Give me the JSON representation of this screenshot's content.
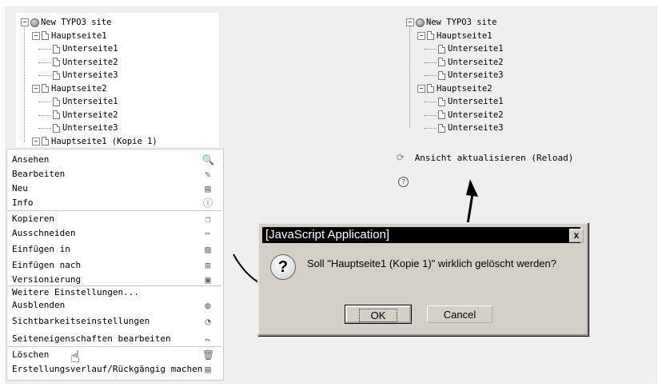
{
  "left_tree": {
    "root": "New TYPO3 site",
    "items": [
      {
        "label": "Hauptseite1"
      },
      {
        "label": "Unterseite1"
      },
      {
        "label": "Unterseite2"
      },
      {
        "label": "Unterseite3"
      },
      {
        "label": "Hauptseite2"
      },
      {
        "label": "Unterseite1"
      },
      {
        "label": "Unterseite2"
      },
      {
        "label": "Unterseite3"
      },
      {
        "label": "Hauptseite1 (Kopie 1)"
      }
    ]
  },
  "right_tree": {
    "root": "New TYPO3 site",
    "items": [
      {
        "label": "Hauptseite1"
      },
      {
        "label": "Unterseite1"
      },
      {
        "label": "Unterseite2"
      },
      {
        "label": "Unterseite3"
      },
      {
        "label": "Hauptseite2"
      },
      {
        "label": "Unterseite1"
      },
      {
        "label": "Unterseite2"
      },
      {
        "label": "Unterseite3"
      }
    ],
    "reload": "Ansicht aktualisieren (Reload)"
  },
  "context_menu": {
    "items": [
      {
        "label": "Ansehen",
        "icon": "magnifier-icon",
        "glyph": "🔍"
      },
      {
        "label": "Bearbeiten",
        "icon": "edit-icon",
        "glyph": "✎"
      },
      {
        "label": "Neu",
        "icon": "new-icon",
        "glyph": "▤"
      },
      {
        "label": "Info",
        "icon": "info-icon",
        "glyph": "ⓘ"
      },
      {
        "label": "Kopieren",
        "icon": "copy-icon",
        "glyph": "❐"
      },
      {
        "label": "Ausschneiden",
        "icon": "scissors-icon",
        "glyph": "✂"
      },
      {
        "label": "Einfügen in",
        "icon": "paste-into-icon",
        "glyph": "▨"
      },
      {
        "label": "Einfügen nach",
        "icon": "paste-after-icon",
        "glyph": "⊞"
      },
      {
        "label": "Versionierung",
        "icon": "version-icon",
        "glyph": "▣"
      },
      {
        "label": "Weitere Einstellungen...",
        "icon": "",
        "glyph": ""
      },
      {
        "label": "Ausblenden",
        "icon": "hide-icon",
        "glyph": "◍"
      },
      {
        "label": "Sichtbarkeitseinstellungen",
        "icon": "visibility-icon",
        "glyph": "◔"
      },
      {
        "label": "Seiteneigenschaften bearbeiten",
        "icon": "pencil-icon",
        "glyph": "✏"
      },
      {
        "label": "Löschen",
        "icon": "trash-icon",
        "glyph": "🗑"
      },
      {
        "label": "Erstellungsverlauf/Rückgängig machen",
        "icon": "history-icon",
        "glyph": "▤"
      }
    ]
  },
  "dialog": {
    "title": "[JavaScript Application]",
    "close": "x",
    "message": "Soll \"Hauptseite1 (Kopie 1)\" wirklich gelöscht werden?",
    "ok": "OK",
    "cancel": "Cancel"
  }
}
